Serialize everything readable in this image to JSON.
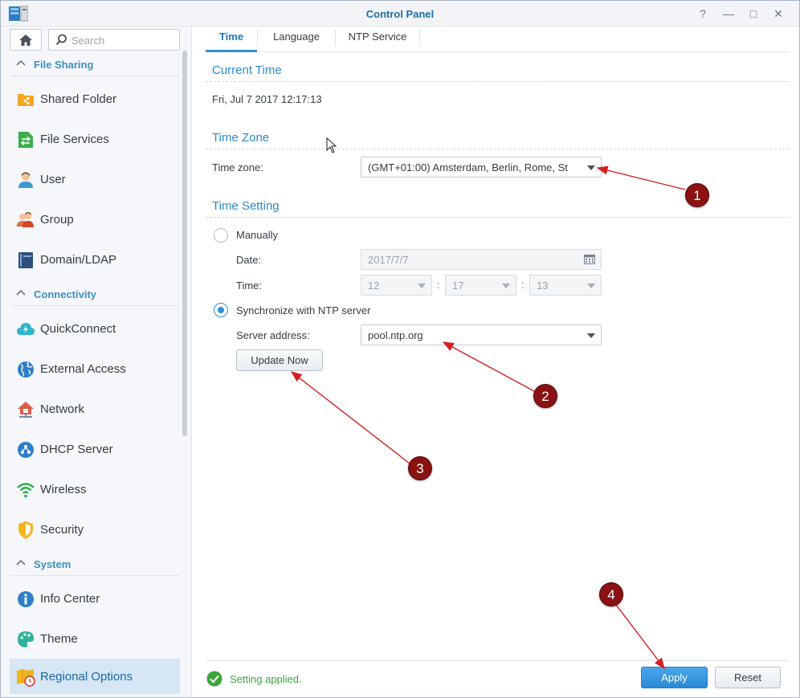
{
  "window": {
    "title": "Control Panel",
    "controls": [
      "?",
      "—",
      "□",
      "✕"
    ]
  },
  "sidebar": {
    "search_placeholder": "Search",
    "sections": [
      {
        "label": "File Sharing"
      },
      {
        "label": "Connectivity"
      },
      {
        "label": "System"
      }
    ],
    "items": [
      {
        "label": "Shared Folder",
        "icon": "shared-folder-icon"
      },
      {
        "label": "File Services",
        "icon": "file-services-icon"
      },
      {
        "label": "User",
        "icon": "user-icon"
      },
      {
        "label": "Group",
        "icon": "group-icon"
      },
      {
        "label": "Domain/LDAP",
        "icon": "domain-icon"
      },
      {
        "label": "QuickConnect",
        "icon": "quickconnect-icon"
      },
      {
        "label": "External Access",
        "icon": "globe-icon"
      },
      {
        "label": "Network",
        "icon": "network-icon"
      },
      {
        "label": "DHCP Server",
        "icon": "dhcp-icon"
      },
      {
        "label": "Wireless",
        "icon": "wireless-icon"
      },
      {
        "label": "Security",
        "icon": "shield-icon"
      },
      {
        "label": "Info Center",
        "icon": "info-icon"
      },
      {
        "label": "Theme",
        "icon": "palette-icon"
      },
      {
        "label": "Regional Options",
        "icon": "regional-icon",
        "active": true
      }
    ]
  },
  "tabs": [
    {
      "label": "Time",
      "active": true
    },
    {
      "label": "Language"
    },
    {
      "label": "NTP Service"
    }
  ],
  "current_time": {
    "title": "Current Time",
    "value": "Fri, Jul 7 2017 12:17:13"
  },
  "time_zone": {
    "title": "Time Zone",
    "label": "Time zone:",
    "value": "(GMT+01:00) Amsterdam, Berlin, Rome, St"
  },
  "time_setting": {
    "title": "Time Setting",
    "manual_label": "Manually",
    "date_label": "Date:",
    "date_value": "2017/7/7",
    "time_label": "Time:",
    "hour": "12",
    "minute": "17",
    "second": "13",
    "colon": ":",
    "ntp_label": "Synchronize with NTP server",
    "ntp_selected": true,
    "server_label": "Server address:",
    "server_value": "pool.ntp.org",
    "update_button": "Update Now"
  },
  "footer": {
    "status": "Setting applied.",
    "apply": "Apply",
    "reset": "Reset"
  },
  "annotations": [
    "1",
    "2",
    "3",
    "4"
  ],
  "colors": {
    "accent": "#2f8ed4",
    "marker": "#8a1212",
    "arrow": "#d42020",
    "success": "#3aa63c"
  }
}
